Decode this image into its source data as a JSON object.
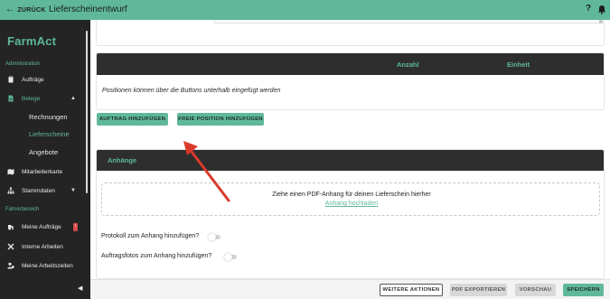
{
  "header": {
    "back_label": "ZURÜCK",
    "title": "Lieferscheinentwurf",
    "help_icon": "question-mark-icon",
    "bell_icon": "bell-icon"
  },
  "sidebar": {
    "logo": "FarmAct",
    "section_admin": "Administration",
    "section_driver": "Fahrerbereich",
    "items": {
      "auftraege": "Aufträge",
      "belege": "Belege",
      "rechnungen": "Rechnungen",
      "lieferscheine": "Lieferscheine",
      "angebote": "Angebote",
      "mitarbeiterkarte": "Mitarbeiterkarte",
      "stammdaten": "Stammdaten",
      "meine_auftraege": "Meine Aufträge",
      "interne_arbeiten": "Interne Arbeiten",
      "meine_arbeitszeiten": "Meine Arbeitszeiten"
    },
    "badge": "!",
    "collapse_label": "◀"
  },
  "positions": {
    "col_anzahl": "Anzahl",
    "col_einheit": "Einheit",
    "hint": "Positionen können über die Buttons unterhalb eingefügt werden",
    "btn_add_order": "AUFTRAG HINZUFÜGEN",
    "btn_add_free": "FREIE POSITION HINZUFÜGEN"
  },
  "attachments": {
    "title": "Anhänge",
    "drop_text": "Ziehe einen PDF-Anhang für deinen Lieferschein hierher",
    "upload_link": "Anhang hochladen",
    "toggle_protocol": "Protokoll zum Anhang hinzufügen?",
    "toggle_photos": "Auftragsfotos zum Anhang hinzufügen?",
    "toggle_protocol_on": false,
    "toggle_photos_on": false
  },
  "footer": {
    "more_actions": "WEITERE AKTIONEN",
    "export_pdf": "PDF EXPORTIEREN",
    "preview": "VORSCHAU",
    "save": "SPEICHERN"
  },
  "colors": {
    "accent": "#5fb89a",
    "sidebar_bg": "#242424",
    "table_header_bg": "#2e2e2e",
    "annotation_arrow": "#d93a2b",
    "badge": "#d94a4a"
  }
}
